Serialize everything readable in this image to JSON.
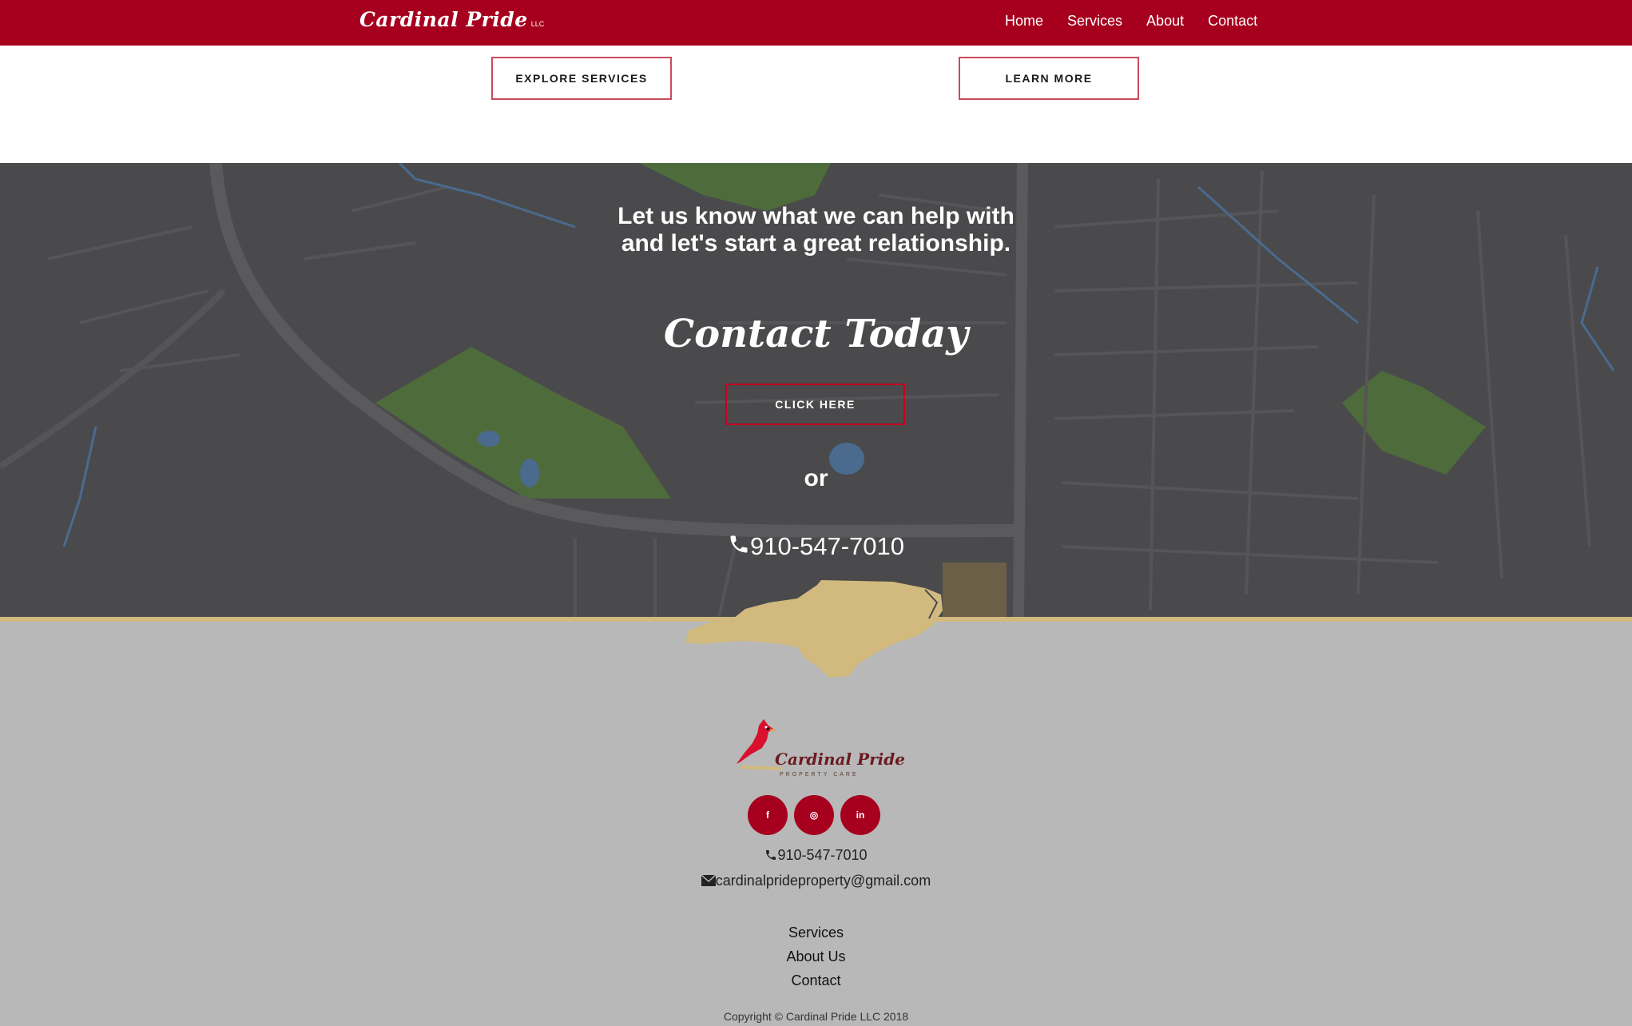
{
  "navbar": {
    "brand": "Cardinal Pride",
    "brand_suffix": "LLC",
    "links": [
      "Home",
      "Services",
      "About",
      "Contact"
    ]
  },
  "cta_strip": {
    "explore_label": "EXPLORE SERVICES",
    "learn_label": "LEARN MORE"
  },
  "contact_section": {
    "headline_line1": "Let us know what we can help with",
    "headline_line2": "and let's start a great relationship.",
    "title": "Contact Today",
    "button_label": "CLICK HERE",
    "or_text": "or",
    "phone": "910-547-7010"
  },
  "footer": {
    "logo_name": "Cardinal Pride",
    "logo_tagline": "PROPERTY CARE",
    "socials": [
      {
        "name": "facebook-icon",
        "glyph": "f"
      },
      {
        "name": "instagram-icon",
        "glyph": "◎"
      },
      {
        "name": "linkedin-icon",
        "glyph": "in"
      }
    ],
    "phone": "910-547-7010",
    "email": "cardinalprideproperty@gmail.com",
    "links": [
      "Services",
      "About Us",
      "Contact"
    ],
    "copyright": "Copyright © Cardinal Pride LLC 2018"
  },
  "colors": {
    "brand_red": "#a6001e",
    "gold": "#d2b97e",
    "map_gray": "#4a4a4c",
    "footer_gray": "#b8b8b8"
  }
}
